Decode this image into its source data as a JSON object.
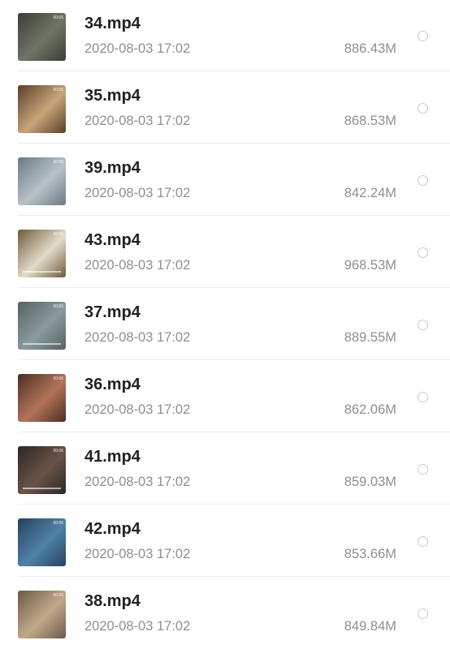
{
  "files": [
    {
      "name": "34.mp4",
      "date": "2020-08-03 17:02",
      "size": "886.43M",
      "duration": "00:06",
      "thumb_colors": [
        "#3b3f35",
        "#6e7466"
      ],
      "sub": false
    },
    {
      "name": "35.mp4",
      "date": "2020-08-03 17:02",
      "size": "868.53M",
      "duration": "00:06",
      "thumb_colors": [
        "#5a3e28",
        "#c9a57a"
      ],
      "sub": false
    },
    {
      "name": "39.mp4",
      "date": "2020-08-03 17:02",
      "size": "842.24M",
      "duration": "00:06",
      "thumb_colors": [
        "#6c7a86",
        "#b7c1c6"
      ],
      "sub": false
    },
    {
      "name": "43.mp4",
      "date": "2020-08-03 17:02",
      "size": "968.53M",
      "duration": "00:06",
      "thumb_colors": [
        "#6f5a3d",
        "#e3dcc9"
      ],
      "sub": true
    },
    {
      "name": "37.mp4",
      "date": "2020-08-03 17:02",
      "size": "889.55M",
      "duration": "00:06",
      "thumb_colors": [
        "#556262",
        "#8a9a9c"
      ],
      "sub": true
    },
    {
      "name": "36.mp4",
      "date": "2020-08-03 17:02",
      "size": "862.06M",
      "duration": "00:06",
      "thumb_colors": [
        "#4b2e22",
        "#b4745a"
      ],
      "sub": false
    },
    {
      "name": "41.mp4",
      "date": "2020-08-03 17:02",
      "size": "859.03M",
      "duration": "00:06",
      "thumb_colors": [
        "#2c2623",
        "#6a5348"
      ],
      "sub": true
    },
    {
      "name": "42.mp4",
      "date": "2020-08-03 17:02",
      "size": "853.66M",
      "duration": "00:06",
      "thumb_colors": [
        "#26415e",
        "#4f82a8"
      ],
      "sub": false
    },
    {
      "name": "38.mp4",
      "date": "2020-08-03 17:02",
      "size": "849.84M",
      "duration": "00:06",
      "thumb_colors": [
        "#6c5a48",
        "#c2a88a"
      ],
      "sub": false
    }
  ]
}
